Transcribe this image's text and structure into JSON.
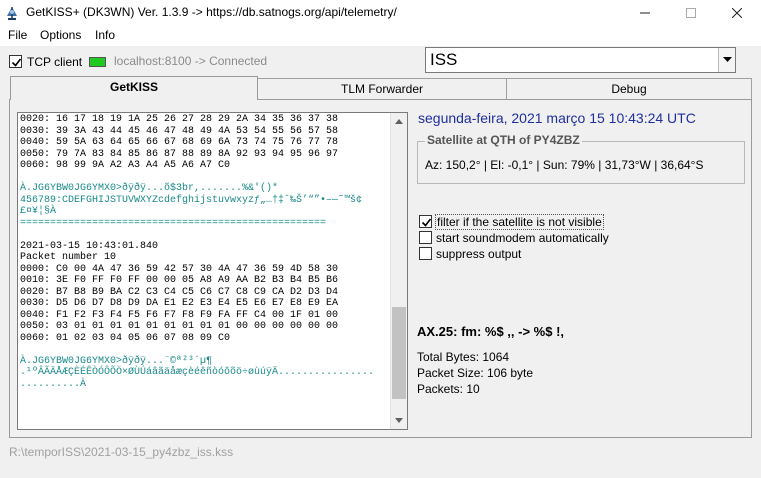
{
  "window": {
    "title": "GetKISS+ (DK3WN) Ver. 1.3.9 -> https://db.satnogs.org/api/telemetry/",
    "minimize_icon": "minimize-icon",
    "maximize_icon": "maximize-icon",
    "close_icon": "close-icon"
  },
  "menu": {
    "file": "File",
    "options": "Options",
    "info": "Info"
  },
  "toolbar": {
    "tcp_client_label": "TCP client",
    "tcp_client_checked": true,
    "connection_status": "localhost:8100 -> Connected",
    "status_color": "#22c922",
    "satellite": "ISS"
  },
  "tabs": [
    "GetKISS",
    "TLM Forwarder",
    "Debug"
  ],
  "log": {
    "lines": [
      {
        "k": "t",
        "s": "0020: 16 17 18 19 1A 25 26 27 28 29 2A 34 35 36 37 38"
      },
      {
        "k": "t",
        "s": "0030: 39 3A 43 44 45 46 47 48 49 4A 53 54 55 56 57 58"
      },
      {
        "k": "t",
        "s": "0040: 59 5A 63 64 65 66 67 68 69 6A 73 74 75 76 77 78"
      },
      {
        "k": "t",
        "s": "0050: 79 7A 83 84 85 86 87 88 89 8A 92 93 94 95 96 97"
      },
      {
        "k": "t",
        "s": "0060: 98 99 9A A2 A3 A4 A5 A6 A7 C0"
      },
      {
        "k": "t",
        "s": ""
      },
      {
        "k": "c",
        "s": "À.JG6YBW0JG6YMX0>ðÿðÿ...õ$3br,.......%&'()*"
      },
      {
        "k": "c",
        "s": "456789:CDEFGHIJSTUVWXYZcdefghijstuvwxyzƒ„…†‡ˆ‰Š’“”•–—˜™š¢"
      },
      {
        "k": "c",
        "s": "£¤¥¦§À"
      },
      {
        "k": "c",
        "s": "==================================================="
      },
      {
        "k": "t",
        "s": ""
      },
      {
        "k": "t",
        "s": "2021-03-15 10:43:01.840"
      },
      {
        "k": "t",
        "s": "Packet number 10"
      },
      {
        "k": "t",
        "s": "0000: C0 00 4A 47 36 59 42 57 30 4A 47 36 59 4D 58 30"
      },
      {
        "k": "t",
        "s": "0010: 3E F0 FF F0 FF 00 00 05 A8 A9 AA B2 B3 B4 B5 B6"
      },
      {
        "k": "t",
        "s": "0020: B7 B8 B9 BA C2 C3 C4 C5 C6 C7 C8 C9 CA D2 D3 D4"
      },
      {
        "k": "t",
        "s": "0030: D5 D6 D7 D8 D9 DA E1 E2 E3 E4 E5 E6 E7 E8 E9 EA"
      },
      {
        "k": "t",
        "s": "0040: F1 F2 F3 F4 F5 F6 F7 F8 F9 FA FF C4 00 1F 01 00"
      },
      {
        "k": "t",
        "s": "0050: 03 01 01 01 01 01 01 01 01 01 00 00 00 00 00 00"
      },
      {
        "k": "t",
        "s": "0060: 01 02 03 04 05 06 07 08 09 C0"
      },
      {
        "k": "t",
        "s": ""
      },
      {
        "k": "c",
        "s": "À.JG6YBW0JG6YMX0>ðÿðÿ...¨©ª²³´µ¶"
      },
      {
        "k": "c",
        "s": ".¹ºÂÃÄÅÆÇÈÉÊÒÓÔÕÖ×ØÙÚáâãäåæçèéêñòóôõö÷øùúÿÄ................"
      },
      {
        "k": "c",
        "s": "..........À"
      }
    ]
  },
  "right": {
    "datetime": "segunda-feira, 2021 março 15  10:43:24 UTC",
    "qth_title": "Satellite at QTH of PY4ZBZ",
    "qth_value": "Az: 150,2° | El: -0,1° | Sun: 79% | 31,73°W | 36,64°S",
    "options": [
      {
        "label": "filter if the satellite is not visible",
        "checked": true
      },
      {
        "label": "start soundmodem automatically",
        "checked": false
      },
      {
        "label": "suppress output",
        "checked": false
      }
    ],
    "ax25": "AX.25: fm: %$ ,, -> %$ !,",
    "total_bytes": "Total Bytes: 1064",
    "packet_size": "Packet Size: 106 byte",
    "packets": "Packets: 10"
  },
  "footer": {
    "file_path": "R:\\temporISS\\2021-03-15_py4zbz_iss.kss"
  }
}
